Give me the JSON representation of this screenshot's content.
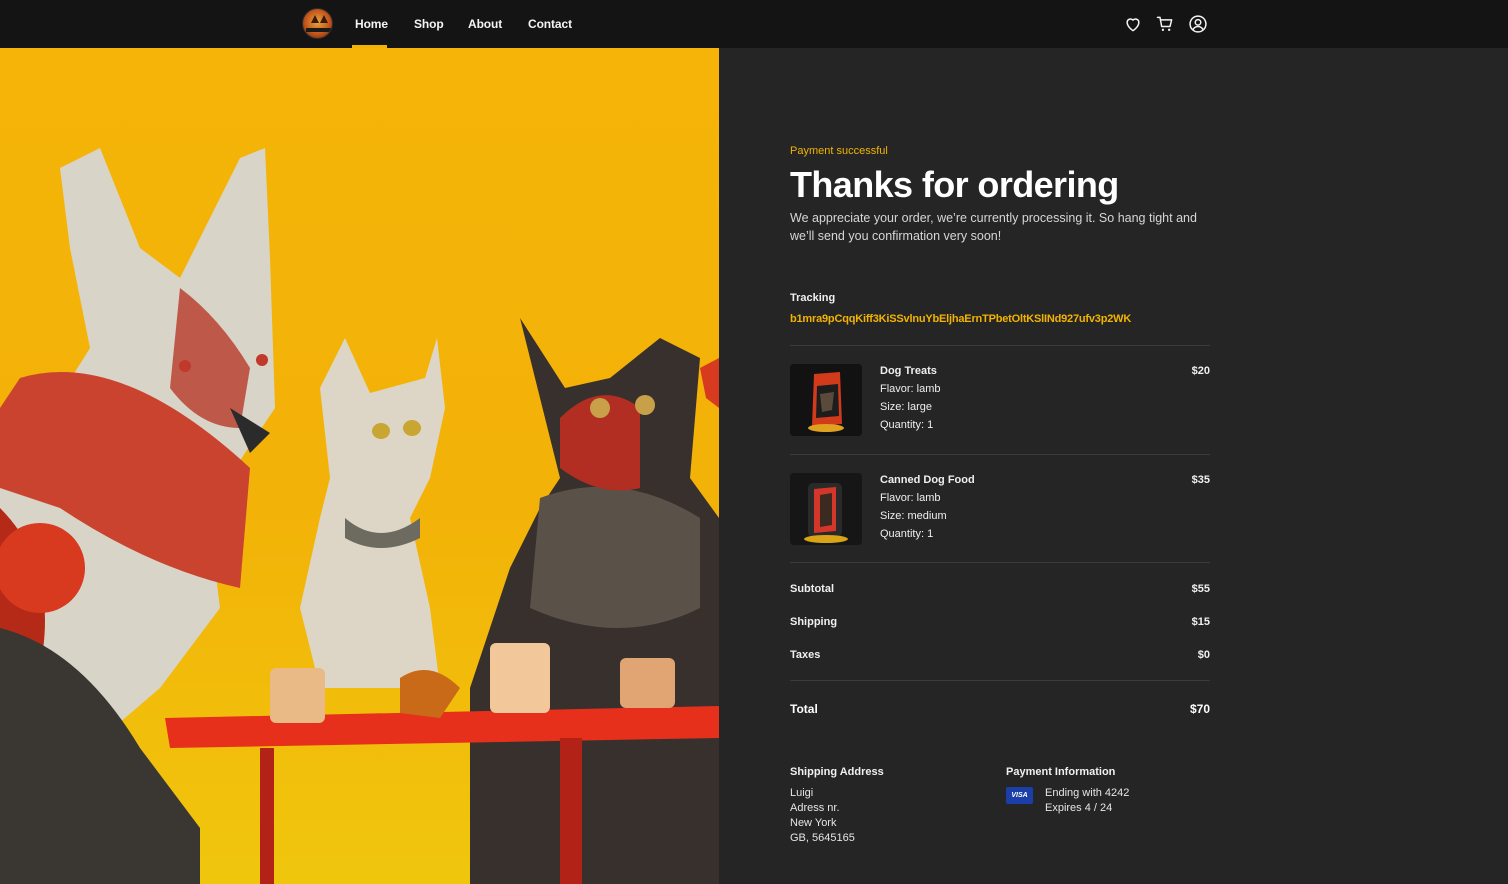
{
  "nav": {
    "links": [
      "Home",
      "Shop",
      "About",
      "Contact"
    ],
    "active": "Home"
  },
  "icons": {
    "wishlist": "heart-icon",
    "cart": "cart-icon",
    "account": "user-circle-icon"
  },
  "colors": {
    "accent": "#f2b400",
    "background": "#252525",
    "nav_background": "#141414",
    "hero_yellow": "#f5b407"
  },
  "order": {
    "status": "Payment successful",
    "title": "Thanks for ordering",
    "message": "We appreciate your order, we’re currently processing it. So hang tight and we’ll send you confirmation very soon!",
    "tracking_label": "Tracking",
    "tracking_number": "b1mra9pCqqKiff3KiSSvlnuYbEljhaErnTPbetOltKSlINd927ufv3p2WK"
  },
  "items": [
    {
      "name": "Dog Treats",
      "flavor": "Flavor: lamb",
      "size": "Size: large",
      "quantity": "Quantity: 1",
      "price": "$20"
    },
    {
      "name": "Canned Dog Food",
      "flavor": "Flavor: lamb",
      "size": "Size: medium",
      "quantity": "Quantity: 1",
      "price": "$35"
    }
  ],
  "summary": {
    "subtotal_label": "Subtotal",
    "subtotal": "$55",
    "shipping_label": "Shipping",
    "shipping": "$15",
    "taxes_label": "Taxes",
    "taxes": "$0",
    "total_label": "Total",
    "total": "$70"
  },
  "shipping_address": {
    "heading": "Shipping Address",
    "lines": [
      "Luigi",
      "Adress nr.",
      "New York",
      "GB, 5645165"
    ]
  },
  "payment": {
    "heading": "Payment Information",
    "card_brand": "VISA",
    "ending": "Ending with 4242",
    "expires": "Expires 4 / 24"
  }
}
